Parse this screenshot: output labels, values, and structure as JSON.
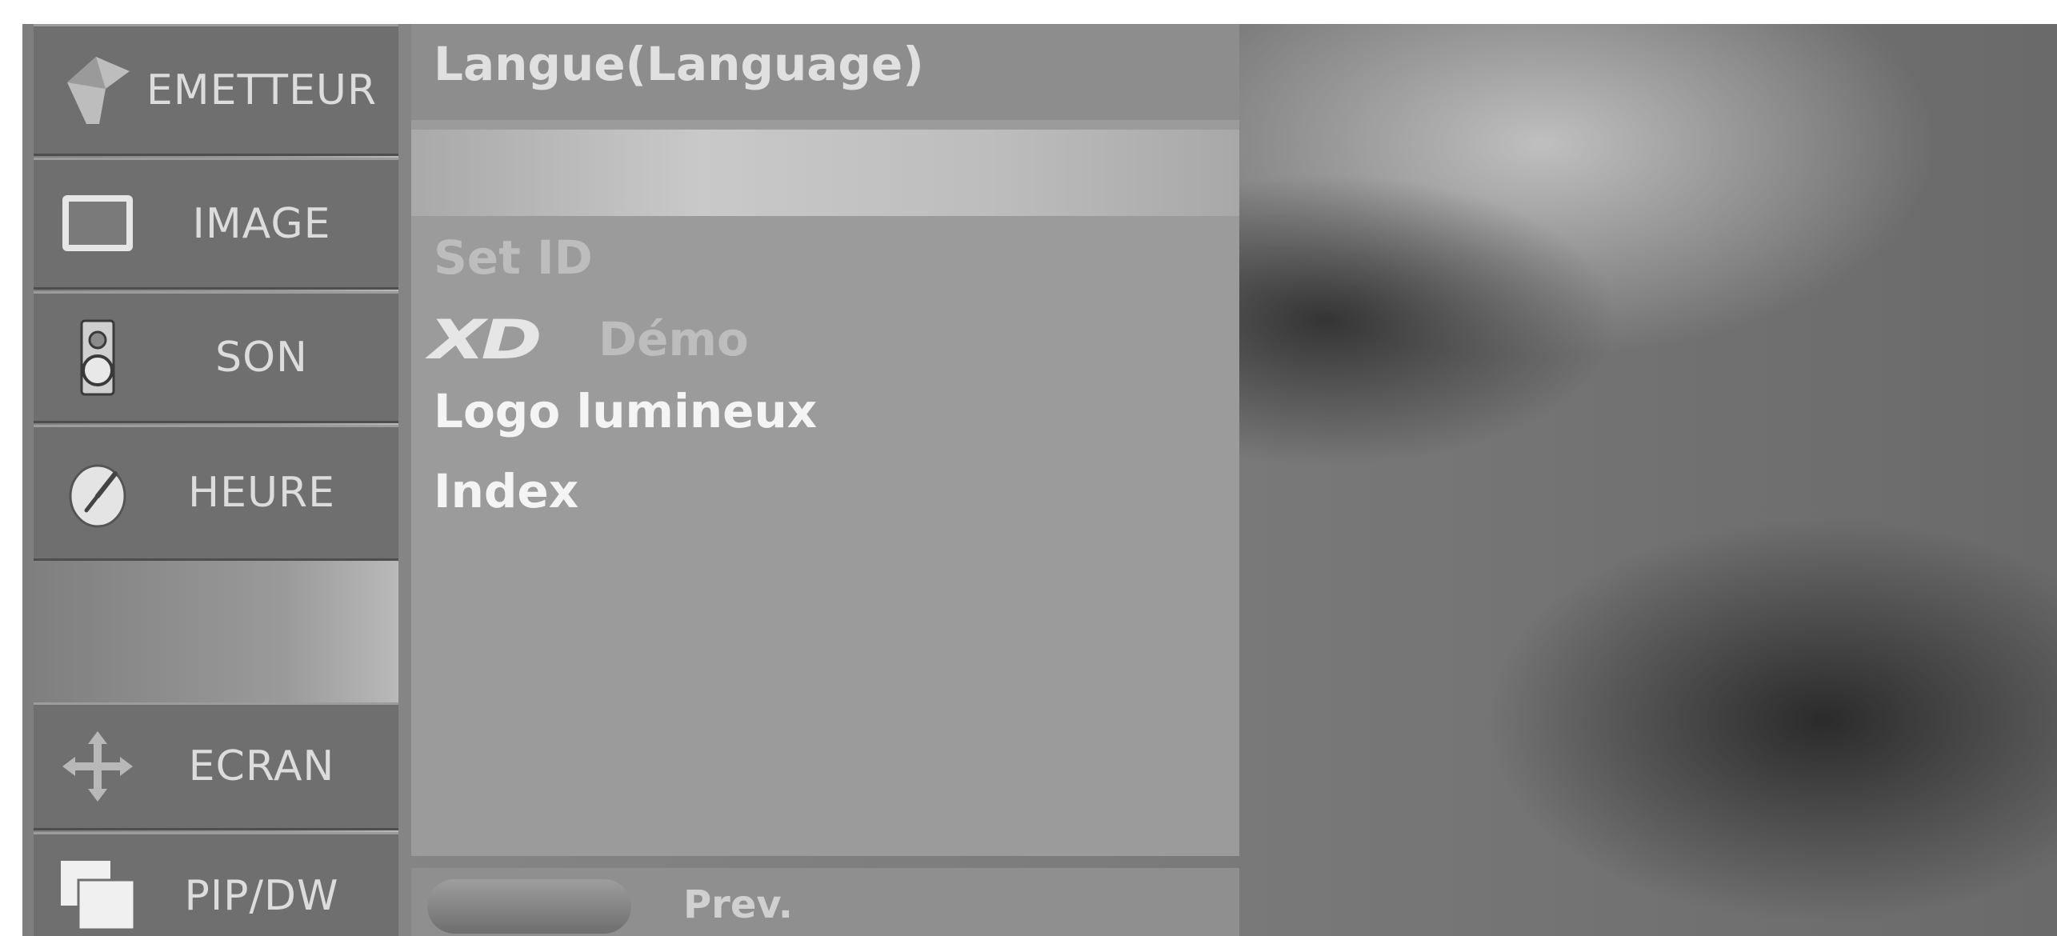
{
  "sidebar": {
    "items": [
      {
        "label": "EMETTEUR",
        "icon": "satellite-dish-icon"
      },
      {
        "label": "IMAGE",
        "icon": "picture-frame-icon"
      },
      {
        "label": "SON",
        "icon": "speaker-icon"
      },
      {
        "label": "HEURE",
        "icon": "clock-icon"
      },
      {
        "label": "ECRAN",
        "icon": "move-arrows-icon"
      },
      {
        "label": "PIP/DW",
        "icon": "pip-windows-icon"
      }
    ]
  },
  "panel": {
    "title": "Langue(Language)",
    "items": [
      {
        "label": "Set ID"
      },
      {
        "label": "Démo",
        "logo": "XD"
      },
      {
        "label": "Logo lumineux"
      },
      {
        "label": "Index"
      }
    ]
  },
  "footer": {
    "prev_label": "Prev."
  }
}
